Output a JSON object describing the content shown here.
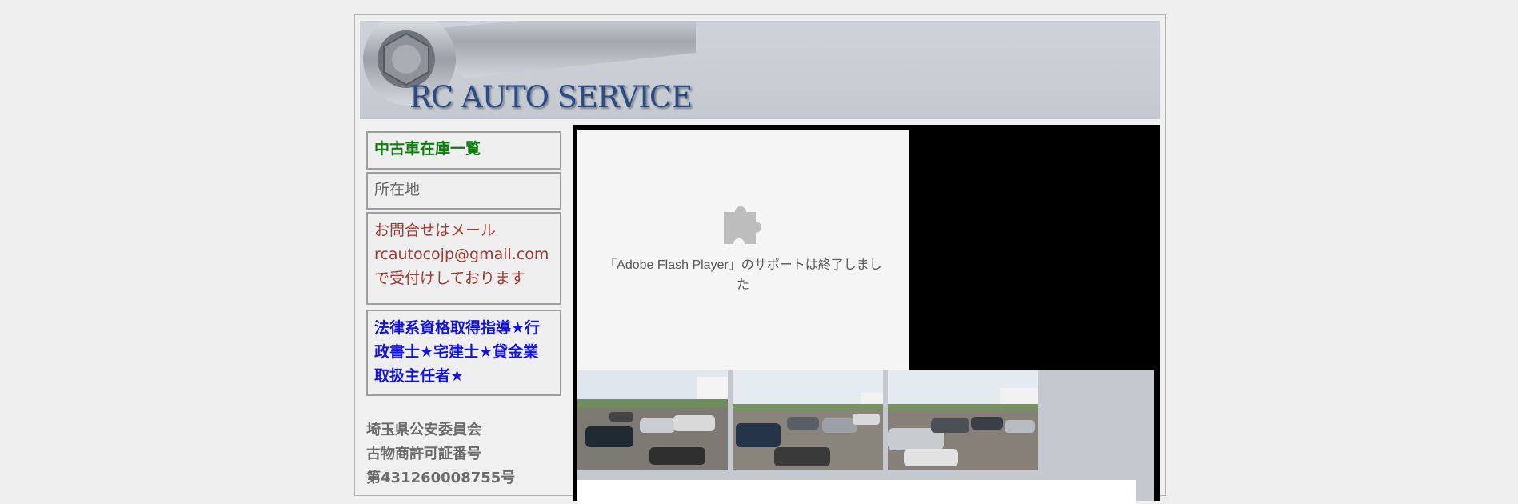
{
  "header": {
    "logo_text": "RC AUTO SERVICE"
  },
  "sidebar": {
    "items": [
      {
        "label": "中古車在庫一覧",
        "color": "#0d7d0d"
      },
      {
        "label": "所在地",
        "color": "#666666"
      },
      {
        "lines": [
          "お問合せはメール",
          "rcautocojp@gmail.com",
          "で受付けしております"
        ],
        "color": "#9b3b33"
      },
      {
        "lines": [
          "法律系資格取得指導★行",
          "政書士★宅建士★貸金業",
          "取扱主任者★"
        ],
        "color": "#1414d6"
      }
    ],
    "license_lines": [
      "埼玉県公安委員会",
      "古物商許可証番号",
      "第431260008755号"
    ]
  },
  "main": {
    "flash_message_lines": [
      "「Adobe Flash Player」のサポートは終了しまし",
      "た"
    ],
    "plugin_icon": "puzzle-piece-icon",
    "photos": [
      "used-car-lot-photo",
      "used-car-lot-photo",
      "used-car-lot-photo"
    ]
  },
  "colors": {
    "page_bg": "#efefef",
    "header_bg": "#c4c9d0",
    "logo": "#2b4b86",
    "main_bg": "#000000"
  }
}
